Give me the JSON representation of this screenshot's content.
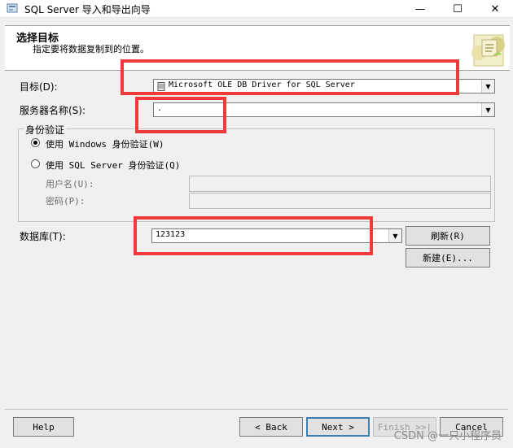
{
  "window": {
    "title": "SQL Server 导入和导出向导",
    "controls": {
      "minimize": "—",
      "maximize": "☐",
      "close": "✕"
    }
  },
  "header": {
    "title": "选择目标",
    "subtitle": "指定要将数据复制到的位置。",
    "icon": "wizard-banner-icon"
  },
  "form": {
    "destination": {
      "label": "目标(D):",
      "value": "Microsoft OLE DB Driver for SQL Server"
    },
    "server": {
      "label": "服务器名称(S):",
      "value": "."
    },
    "auth": {
      "group_label": "身份验证",
      "windows_option": "使用 Windows 身份验证(W)",
      "windows_selected": true,
      "sql_option": "使用 SQL Server 身份验证(Q)",
      "username_label": "用户名(U):",
      "password_label": "密码(P):",
      "username_value": "",
      "password_value": ""
    },
    "database": {
      "label": "数据库(T):",
      "value": "123123"
    },
    "refresh_button": "刷新(R)",
    "new_button": "新建(E)..."
  },
  "footer": {
    "help": "Help",
    "back": "< Back",
    "next": "Next >",
    "finish": "Finish >>|",
    "cancel": "Cancel"
  },
  "watermark": "CSDN @一只小程序员",
  "colors": {
    "highlight": "#f03a3a",
    "background": "#f0f0f0"
  }
}
